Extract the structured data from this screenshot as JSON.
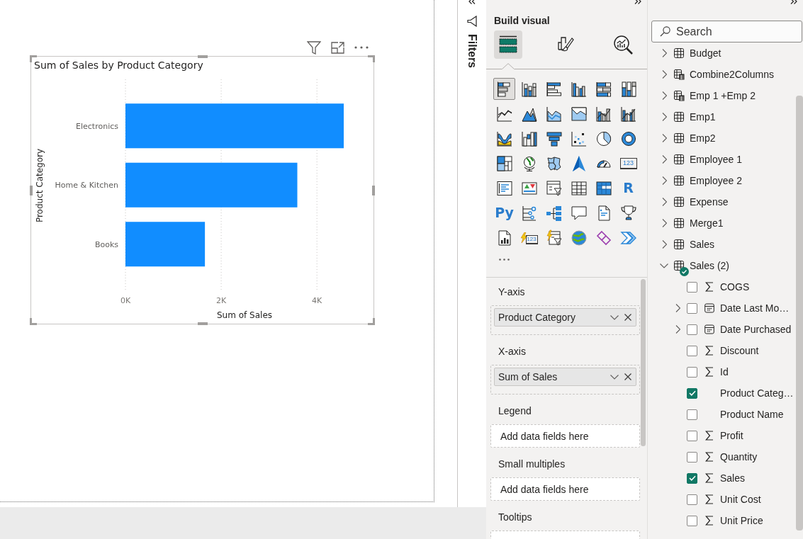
{
  "canvas": {
    "visual": {
      "selected": true,
      "chart_data": {
        "type": "bar",
        "orientation": "horizontal",
        "title": "Sum of Sales by Product Category",
        "xlabel": "Sum of Sales",
        "ylabel": "Product Category",
        "categories": [
          "Electronics",
          "Home & Kitchen",
          "Books"
        ],
        "series": [
          {
            "color": "#118dff",
            "values": [
              4560,
              3590,
              1660
            ]
          }
        ],
        "xlim": [
          0,
          4560
        ],
        "xticks": [
          {
            "value": 0,
            "label": "0K"
          },
          {
            "value": 2000,
            "label": "2K"
          },
          {
            "value": 4000,
            "label": "4K"
          }
        ]
      }
    }
  },
  "filters_pane": {
    "title": "Filters"
  },
  "visualizations_pane": {
    "section_title": "Build visual",
    "modes": [
      {
        "kind": "fields",
        "selected": true
      },
      {
        "kind": "format",
        "selected": false
      },
      {
        "kind": "analytics",
        "selected": false
      }
    ],
    "visuals": [
      {
        "kind": "stacked-bar",
        "selected": true
      },
      {
        "kind": "stacked-column",
        "selected": false
      },
      {
        "kind": "clustered-bar",
        "selected": false
      },
      {
        "kind": "clustered-column",
        "selected": false
      },
      {
        "kind": "percent-bar",
        "selected": false
      },
      {
        "kind": "percent-column",
        "selected": false
      },
      {
        "kind": "line",
        "selected": false
      },
      {
        "kind": "area",
        "selected": false
      },
      {
        "kind": "stacked-area",
        "selected": false
      },
      {
        "kind": "percent-area",
        "selected": false
      },
      {
        "kind": "line-stacked-column",
        "selected": false
      },
      {
        "kind": "line-clustered-column",
        "selected": false
      },
      {
        "kind": "ribbon",
        "selected": false
      },
      {
        "kind": "waterfall",
        "selected": false
      },
      {
        "kind": "funnel",
        "selected": false
      },
      {
        "kind": "scatter",
        "selected": false
      },
      {
        "kind": "pie",
        "selected": false
      },
      {
        "kind": "donut",
        "selected": false
      },
      {
        "kind": "treemap",
        "selected": false
      },
      {
        "kind": "globe-map",
        "selected": false
      },
      {
        "kind": "filled-map",
        "selected": false
      },
      {
        "kind": "azure-map",
        "selected": false
      },
      {
        "kind": "gauge",
        "selected": false
      },
      {
        "kind": "card",
        "text": "123",
        "selected": false
      },
      {
        "kind": "multi-card",
        "selected": false
      },
      {
        "kind": "kpi",
        "selected": false
      },
      {
        "kind": "slicer",
        "selected": false
      },
      {
        "kind": "table",
        "selected": false
      },
      {
        "kind": "matrix",
        "selected": false
      },
      {
        "kind": "r-script",
        "text": "R",
        "selected": false
      },
      {
        "kind": "python",
        "text": "Py",
        "selected": false
      },
      {
        "kind": "key-influencers",
        "selected": false
      },
      {
        "kind": "decomposition-tree",
        "selected": false
      },
      {
        "kind": "qna",
        "selected": false
      },
      {
        "kind": "narrative",
        "selected": false
      },
      {
        "kind": "metrics",
        "selected": false
      },
      {
        "kind": "paginated",
        "selected": false
      },
      {
        "kind": "lightning-card",
        "text": "123",
        "selected": false
      },
      {
        "kind": "lightning-slicer",
        "selected": false
      },
      {
        "kind": "arcgis",
        "selected": false
      },
      {
        "kind": "power-apps",
        "selected": false
      },
      {
        "kind": "power-automate",
        "selected": false
      }
    ],
    "wells": [
      {
        "label": "Y-axis",
        "fields": [
          {
            "label": "Product Category"
          }
        ]
      },
      {
        "label": "X-axis",
        "fields": [
          {
            "label": "Sum of Sales"
          }
        ]
      },
      {
        "label": "Legend",
        "hint": "Add data fields here"
      },
      {
        "label": "Small multiples",
        "hint": "Add data fields here"
      },
      {
        "label": "Tooltips"
      }
    ]
  },
  "data_pane": {
    "search": {
      "placeholder": "Search"
    },
    "tables": [
      {
        "label": "Budget",
        "kind": "table",
        "expanded": false,
        "in_use": false
      },
      {
        "label": "Combine2Columns",
        "kind": "calculated",
        "expanded": false,
        "in_use": false
      },
      {
        "label": "Emp 1 +Emp 2",
        "kind": "calculated",
        "expanded": false,
        "in_use": false
      },
      {
        "label": "Emp1",
        "kind": "table",
        "expanded": false,
        "in_use": false
      },
      {
        "label": "Emp2",
        "kind": "table",
        "expanded": false,
        "in_use": false
      },
      {
        "label": "Employee 1",
        "kind": "table",
        "expanded": false,
        "in_use": false
      },
      {
        "label": "Employee 2",
        "kind": "table",
        "expanded": false,
        "in_use": false
      },
      {
        "label": "Expense",
        "kind": "table",
        "expanded": false,
        "in_use": false
      },
      {
        "label": "Merge1",
        "kind": "table",
        "expanded": false,
        "in_use": false
      },
      {
        "label": "Sales",
        "kind": "table",
        "expanded": false,
        "in_use": false
      },
      {
        "label": "Sales (2)",
        "kind": "table",
        "expanded": true,
        "in_use": true,
        "fields": [
          {
            "label": "COGS",
            "kind": "sum",
            "checked": false
          },
          {
            "label": "Date Last Mo…",
            "kind": "date",
            "checked": false
          },
          {
            "label": "Date Purchased",
            "kind": "date",
            "checked": false
          },
          {
            "label": "Discount",
            "kind": "sum",
            "checked": false
          },
          {
            "label": "Id",
            "kind": "sum",
            "checked": false
          },
          {
            "label": "Product Categ…",
            "kind": "text",
            "checked": true
          },
          {
            "label": "Product Name",
            "kind": "text",
            "checked": false
          },
          {
            "label": "Profit",
            "kind": "sum",
            "checked": false
          },
          {
            "label": "Quantity",
            "kind": "sum",
            "checked": false
          },
          {
            "label": "Sales",
            "kind": "sum",
            "checked": true
          },
          {
            "label": "Unit Cost",
            "kind": "sum",
            "checked": false
          },
          {
            "label": "Unit Price",
            "kind": "sum",
            "checked": false
          }
        ]
      }
    ]
  }
}
